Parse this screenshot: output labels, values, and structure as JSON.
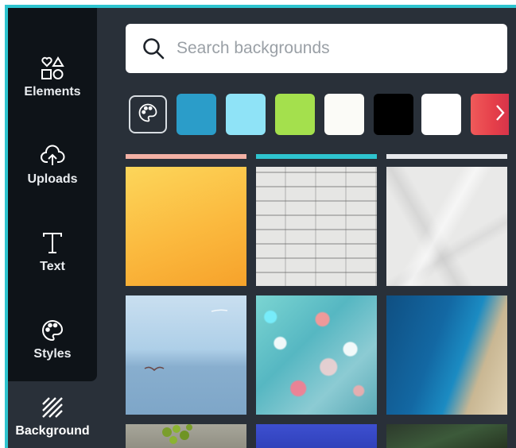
{
  "sidebar": {
    "items": [
      {
        "label": "Elements",
        "icon": "elements-icon"
      },
      {
        "label": "Uploads",
        "icon": "upload-cloud-icon"
      },
      {
        "label": "Text",
        "icon": "text-icon"
      },
      {
        "label": "Styles",
        "icon": "palette-icon"
      },
      {
        "label": "Background",
        "icon": "background-hatch-icon",
        "active": true
      }
    ]
  },
  "search": {
    "placeholder": "Search backgrounds",
    "value": ""
  },
  "swatches": [
    "#2b9dc9",
    "#8fe3f7",
    "#a4e04d",
    "#fbfbf7",
    "#000000",
    "#ffffff",
    "#ef4f56"
  ],
  "strip_colors": [
    "#f3b0a5",
    "#2ec4cf",
    "#e7e9ec"
  ],
  "colors": {
    "accent": "#2ec4cf",
    "sidebar_bg": "#0e1318",
    "panel_bg": "#293039"
  },
  "backgrounds": [
    {
      "name": "orange-gradient"
    },
    {
      "name": "white-brick-wall"
    },
    {
      "name": "crumpled-paper"
    },
    {
      "name": "calm-sea-with-bird"
    },
    {
      "name": "bokeh-lights"
    },
    {
      "name": "coastal-cliff"
    },
    {
      "name": "green-plant-wood"
    },
    {
      "name": "blue-solid"
    },
    {
      "name": "dark-leaves"
    }
  ]
}
